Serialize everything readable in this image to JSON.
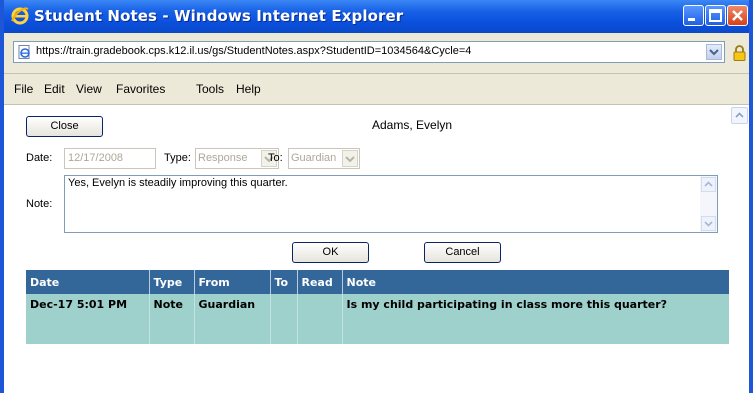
{
  "window": {
    "title": "Student Notes - Windows Internet Explorer"
  },
  "address": {
    "url": "https://train.gradebook.cps.k12.il.us/gs/StudentNotes.aspx?StudentID=1034564&Cycle=4"
  },
  "menu": {
    "items": [
      "File",
      "Edit",
      "View",
      "Favorites",
      "Tools",
      "Help"
    ]
  },
  "form": {
    "close_label": "Close",
    "student_name": "Adams, Evelyn",
    "date_label": "Date:",
    "date_value": "12/17/2008",
    "type_label": "Type:",
    "type_value": "Response",
    "to_label": "To:",
    "to_value": "Guardian",
    "note_label": "Note:",
    "note_value": "Yes, Evelyn is steadily improving this quarter.",
    "ok_label": "OK",
    "cancel_label": "Cancel"
  },
  "grid": {
    "columns": [
      "Date",
      "Type",
      "From",
      "To",
      "Read",
      "Note"
    ],
    "rows": [
      {
        "date": "Dec-17 5:01 PM",
        "type": "Note",
        "from": "Guardian",
        "to": "",
        "read": "",
        "note": "Is my child participating in class more this quarter?"
      }
    ]
  },
  "colors": {
    "title_bar": "#0a4fdc",
    "grid_header": "#336699",
    "grid_row": "#9fd1cc"
  }
}
